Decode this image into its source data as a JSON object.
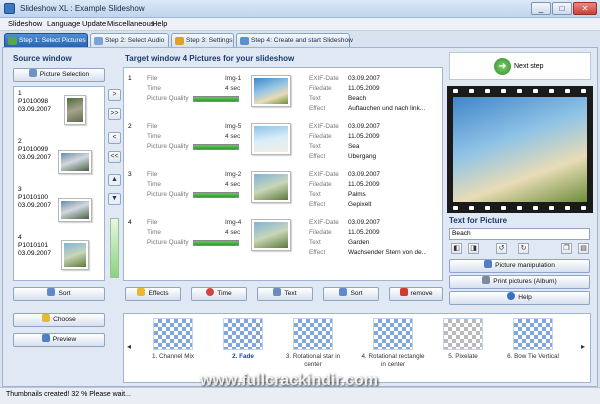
{
  "window": {
    "title": "Slideshow XL : Example Slideshow",
    "minimize": "_",
    "maximize": "□",
    "close": "✕"
  },
  "menu": [
    "Slideshow",
    "Language",
    "Update",
    "Miscellaneous",
    "Help"
  ],
  "tabs": [
    {
      "label": "Step 1: Select Pictures",
      "active": true
    },
    {
      "label": "Step 2: Select Audio",
      "active": false
    },
    {
      "label": "Step 3: Settings",
      "active": false
    },
    {
      "label": "Step 4: Create and start Slideshow",
      "active": false
    }
  ],
  "source": {
    "title": "Source window",
    "select_button": "Picture Selection",
    "items": [
      {
        "num": "1",
        "name": "P1010098",
        "date": "03.09.2007",
        "image": "rock"
      },
      {
        "num": "2",
        "name": "P1010099",
        "date": "03.09.2007",
        "image": "water"
      },
      {
        "num": "3",
        "name": "P1010100",
        "date": "03.09.2007",
        "image": "water"
      },
      {
        "num": "4",
        "name": "P1010101",
        "date": "03.09.2007",
        "image": "tree"
      }
    ],
    "sort_button": "Sort",
    "choose_button": "Choose",
    "preview_button": "Preview"
  },
  "nav_buttons": [
    ">",
    ">>",
    "<",
    "<<"
  ],
  "target": {
    "title": "Target window 4 Pictures for your slideshow",
    "labels": {
      "file": "File",
      "time": "Time",
      "quality": "Picture Quality",
      "exif": "EXIF-Date",
      "filedate": "Filedate",
      "text": "Text",
      "effect": "Effect"
    },
    "items": [
      {
        "num": "1",
        "file": "Img-1",
        "time": "4 sec",
        "quality": 1.0,
        "exif": "03.09.2007",
        "filedate": "11.05.2009",
        "text": "Beach",
        "effect": "Auftauchen und nach link...",
        "image": "beach"
      },
      {
        "num": "2",
        "file": "Img-5",
        "time": "4 sec",
        "quality": 1.0,
        "exif": "03.09.2007",
        "filedate": "11.05.2009",
        "text": "Sea",
        "effect": "Übergang",
        "image": "sea"
      },
      {
        "num": "3",
        "file": "Img-2",
        "time": "4 sec",
        "quality": 1.0,
        "exif": "03.09.2007",
        "filedate": "11.05.2009",
        "text": "Palms",
        "effect": "Gepixelt",
        "image": "tree"
      },
      {
        "num": "4",
        "file": "Img-4",
        "time": "4 sec",
        "quality": 1.0,
        "exif": "03.09.2007",
        "filedate": "11.05.2009",
        "text": "Garden",
        "effect": "Wachsender Stern von de...",
        "image": "tree"
      }
    ],
    "buttons": {
      "effects": "Effects",
      "time": "Time",
      "text": "Text",
      "sort": "Sort",
      "remove": "remove"
    }
  },
  "right": {
    "next_step": "Next step",
    "text_for_picture_label": "Text for Picture",
    "text_value": "Beach",
    "manip_button": "Picture manipulation",
    "print_button": "Print pictures (Album)",
    "help_button": "Help"
  },
  "effects": [
    {
      "label": "1. Channel Mix",
      "selected": false,
      "grey": false
    },
    {
      "label": "2. Fade",
      "selected": true,
      "grey": false
    },
    {
      "label": "3. Rotational star in center",
      "selected": false,
      "grey": false
    },
    {
      "label": "4. Rotational rectangle in center",
      "selected": false,
      "grey": false
    },
    {
      "label": "5. Pixelate",
      "selected": false,
      "grey": true
    },
    {
      "label": "6. Bow Tie Vertical",
      "selected": false,
      "grey": false
    }
  ],
  "status": {
    "text": "Thumbnails created! 32 %  Please wait..."
  },
  "watermark": "www.fullcrackindir.com",
  "colors": {
    "tab_active": "#2a63b0",
    "quality_bar": "#2aa227",
    "panel_bg": "#dfe8f3"
  }
}
